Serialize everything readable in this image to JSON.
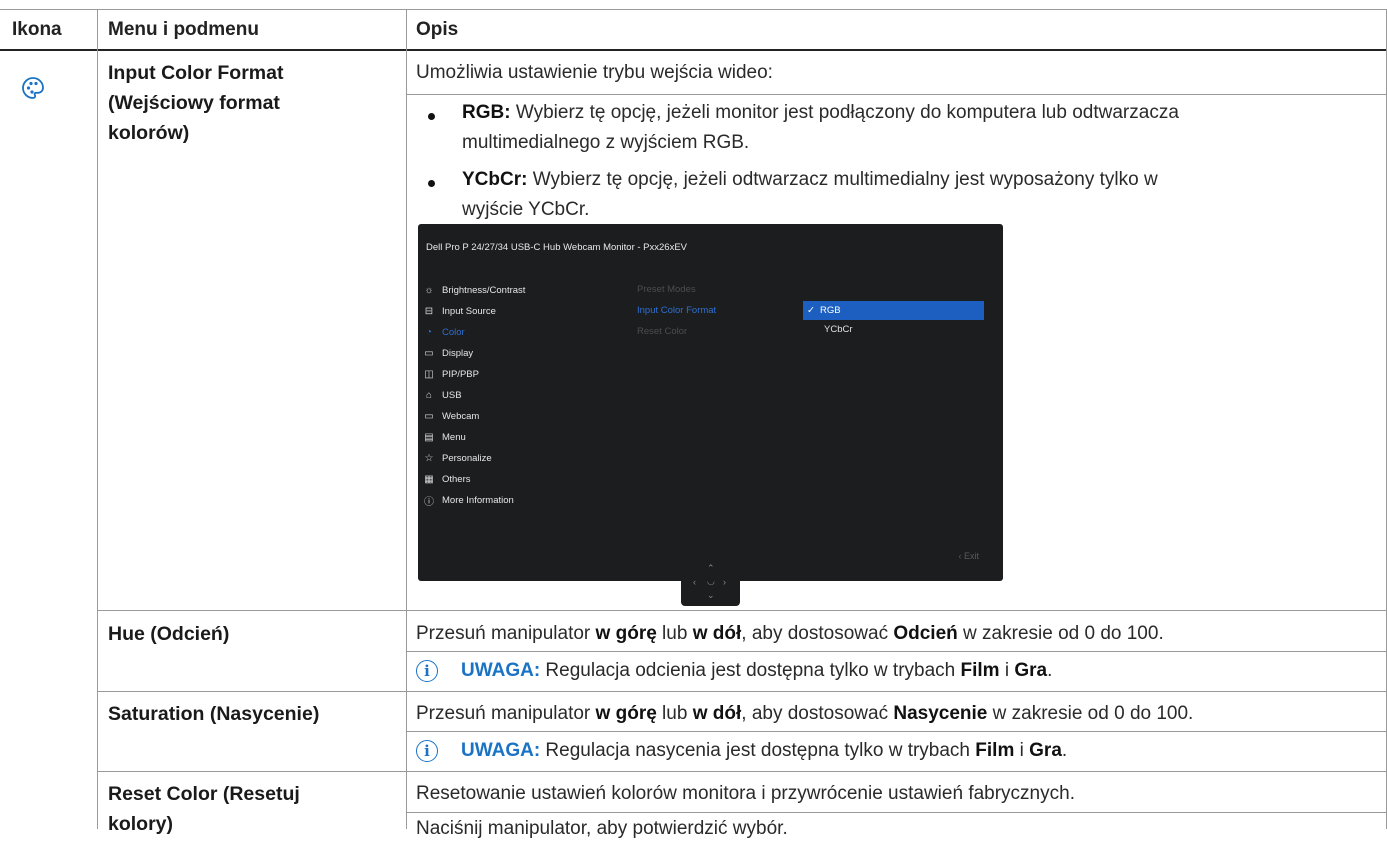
{
  "table": {
    "headers": {
      "icon": "Ikona",
      "menu": "Menu i podmenu",
      "desc": "Opis"
    }
  },
  "icon": {
    "name": "palette-icon",
    "color": "#1a73c4"
  },
  "rows": {
    "input_color": {
      "title_line1": "Input Color Format",
      "title_line2": "(Wejściowy format",
      "title_line3": "kolorów)",
      "intro": "Umożliwia ustawienie trybu wejścia wideo:",
      "rgb_label": "RGB:",
      "rgb_text1": " Wybierz tę opcję, jeżeli monitor jest podłączony do komputera lub odtwarzacza",
      "rgb_text2": "multimedialnego z wyjściem RGB.",
      "ycbcr_label": "YCbCr:",
      "ycbcr_text1": " Wybierz tę opcję, jeżeli odtwarzacz multimedialny jest wyposażony tylko w",
      "ycbcr_text2": "wyjście YCbCr."
    },
    "hue": {
      "title": "Hue (Odcień)",
      "p1": "Przesuń manipulator ",
      "b1": "w górę",
      "p2": " lub ",
      "b2": "w dół",
      "p3": ", aby dostosować ",
      "b3": "Odcień",
      "p4": " w zakresie od 0 do 100.",
      "note_label": "UWAGA:",
      "note_text": " Regulacja odcienia jest dostępna tylko w trybach ",
      "note_b1": "Film",
      "note_mid": " i ",
      "note_b2": "Gra",
      "note_end": "."
    },
    "saturation": {
      "title": "Saturation (Nasycenie)",
      "p1": "Przesuń manipulator ",
      "b1": "w górę",
      "p2": " lub ",
      "b2": "w dół",
      "p3": ", aby dostosować ",
      "b3": "Nasycenie",
      "p4": " w zakresie od 0 do 100.",
      "note_label": "UWAGA:",
      "note_text": " Regulacja nasycenia jest dostępna tylko w trybach ",
      "note_b1": "Film",
      "note_mid": " i ",
      "note_b2": "Gra",
      "note_end": "."
    },
    "reset": {
      "title_line1": "Reset Color (Resetuj",
      "title_line2": "kolory)",
      "line1": "Resetowanie ustawień kolorów monitora i przywrócenie ustawień fabrycznych.",
      "line2": "Naciśnij manipulator, aby potwierdzić wybór."
    }
  },
  "osd": {
    "title": "Dell Pro P 24/27/34 USB-C Hub Webcam Monitor - Pxx26xEV",
    "menu": [
      {
        "label": "Brightness/Contrast",
        "icon": "sun-icon"
      },
      {
        "label": "Input Source",
        "icon": "input-icon"
      },
      {
        "label": "Color",
        "icon": "palette-icon"
      },
      {
        "label": "Display",
        "icon": "monitor-icon"
      },
      {
        "label": "PIP/PBP",
        "icon": "pip-icon"
      },
      {
        "label": "USB",
        "icon": "mouse-icon"
      },
      {
        "label": "Webcam",
        "icon": "camera-icon"
      },
      {
        "label": "Menu",
        "icon": "menu-icon"
      },
      {
        "label": "Personalize",
        "icon": "star-icon"
      },
      {
        "label": "Others",
        "icon": "others-icon"
      },
      {
        "label": "More Information",
        "icon": "info-icon"
      }
    ],
    "submenu": [
      "Preset Modes",
      "Input Color Format",
      "Reset Color"
    ],
    "options": {
      "selected": "RGB",
      "other": "YCbCr"
    },
    "exit": "Exit",
    "accent": "#1d5fc0"
  }
}
